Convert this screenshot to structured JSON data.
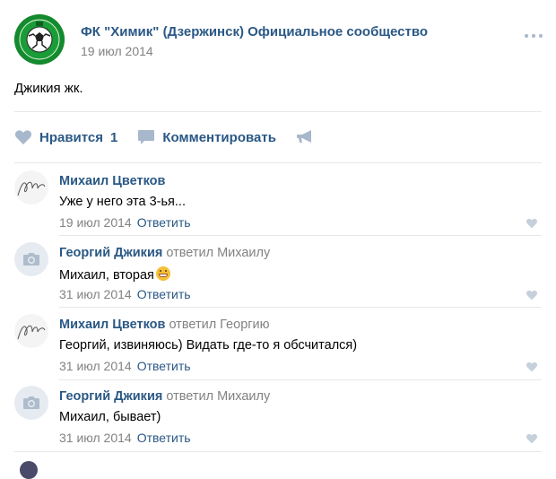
{
  "post": {
    "group_name": "ФК \"Химик\" (Дзержинск) Официальное сообщество",
    "date": "19 июл 2014",
    "text": "Джикия жк.",
    "more_icon": "more-horizontal-icon"
  },
  "actions": {
    "like_label": "Нравится",
    "like_count": "1",
    "comment_label": "Комментировать",
    "share_icon": "megaphone-icon"
  },
  "comments": [
    {
      "author": "Михаил Цветков",
      "replied_to": "",
      "text": "Уже у него эта 3-ья...",
      "date": "19 июл 2014",
      "reply_label": "Ответить",
      "avatar": "signature-avatar"
    },
    {
      "author": "Георгий Джикия",
      "replied_to": "ответил Михаилу",
      "text": "Михаил, вторая",
      "date": "31 июл 2014",
      "reply_label": "Ответить",
      "avatar": "camera-placeholder-avatar",
      "emoji": "grinning-face-emoji"
    },
    {
      "author": "Михаил Цветков",
      "replied_to": "ответил Георгию",
      "text": "Георгий, извиняюсь) Видать где-то я обсчитался)",
      "date": "31 июл 2014",
      "reply_label": "Ответить",
      "avatar": "signature-avatar"
    },
    {
      "author": "Георгий Джикия",
      "replied_to": "ответил Михаилу",
      "text": "Михаил, бывает)",
      "date": "31 июл 2014",
      "reply_label": "Ответить",
      "avatar": "camera-placeholder-avatar"
    }
  ],
  "colors": {
    "link": "#2a5885",
    "muted": "#828282",
    "divider": "#e7e8ec",
    "icon": "#a8b8cc"
  }
}
